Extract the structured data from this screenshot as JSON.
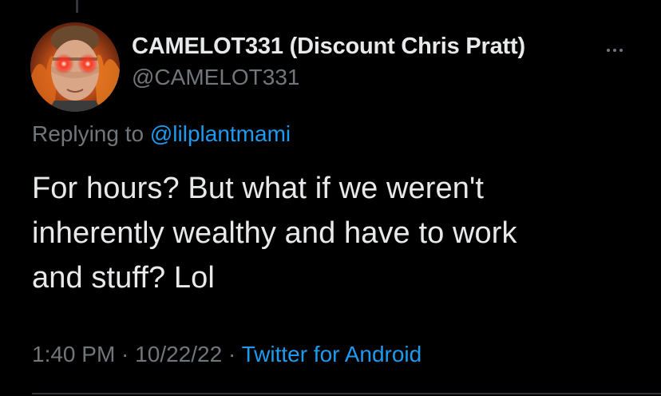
{
  "colors": {
    "background": "#000000",
    "primary_text": "#e7e9ea",
    "secondary_text": "#71767b",
    "accent": "#1d9bf0",
    "divider": "#2f3336"
  },
  "author": {
    "display_name": "CAMELOT331 (Discount Chris Pratt)",
    "handle": "@CAMELOT331",
    "avatar_icon": "profile-avatar-glowing-eyes"
  },
  "more_icon": "more-horizontal-icon",
  "reply": {
    "prefix": "Replying to ",
    "mention": "@lilplantmami"
  },
  "tweet": {
    "line1": "For hours? But what if we weren't",
    "line2": "inherently wealthy and have to work",
    "line3": "and stuff? Lol"
  },
  "meta": {
    "time": "1:40 PM",
    "separator1": " · ",
    "date": "10/22/22",
    "separator2": " · ",
    "source": "Twitter for Android"
  }
}
